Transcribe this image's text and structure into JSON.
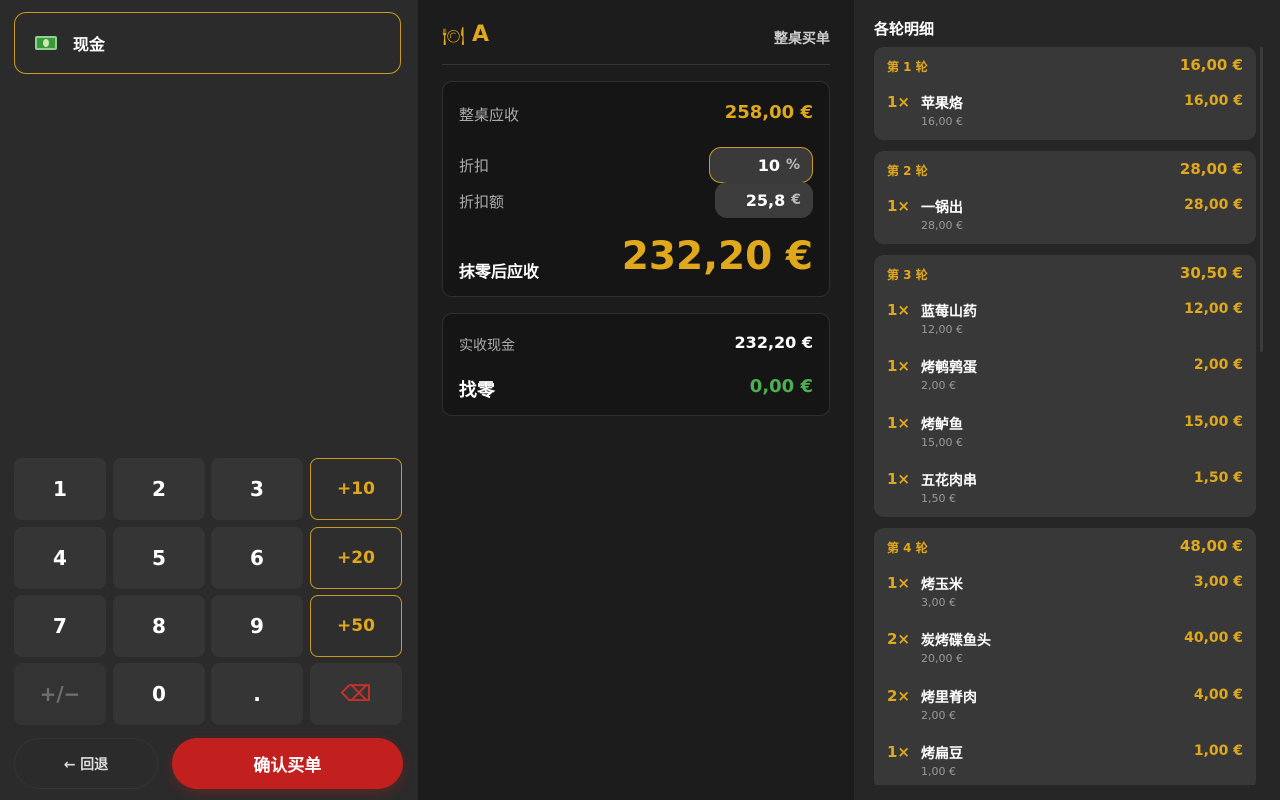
{
  "payment": {
    "method_label": "现金",
    "method_icon": "cash-icon"
  },
  "keypad": {
    "digits": [
      "1",
      "2",
      "3",
      "4",
      "5",
      "6",
      "7",
      "8",
      "9",
      "+/−",
      "0",
      "."
    ],
    "quick": [
      "+10",
      "+20",
      "+50"
    ],
    "backspace_icon": "⌫"
  },
  "actions": {
    "back_label": "← 回退",
    "confirm_label": "确认买单"
  },
  "header": {
    "table_icon": "🍽",
    "table_name": "A",
    "whole_table_label": "整桌买单"
  },
  "summary": {
    "receivable_label": "整桌应收",
    "receivable_value": "258,00 €",
    "discount_label": "折扣",
    "discount_value": "10",
    "discount_unit": "%",
    "discount_amount_label": "折扣额",
    "discount_amount_value": "25,8",
    "discount_amount_unit": "€",
    "rounded_label": "抹零后应收",
    "rounded_value": "232,20 €"
  },
  "cash": {
    "received_label": "实收现金",
    "received_value": "232,20 €",
    "change_label": "找零",
    "change_value": "0,00 €"
  },
  "rounds_title": "各轮明细",
  "rounds": [
    {
      "name": "第 1 轮",
      "total": "16,00 €",
      "items": [
        {
          "qty": "1×",
          "name": "苹果烙",
          "unit": "16,00 €",
          "total": "16,00 €"
        }
      ]
    },
    {
      "name": "第 2 轮",
      "total": "28,00 €",
      "items": [
        {
          "qty": "1×",
          "name": "一锅出",
          "unit": "28,00 €",
          "total": "28,00 €"
        }
      ]
    },
    {
      "name": "第 3 轮",
      "total": "30,50 €",
      "items": [
        {
          "qty": "1×",
          "name": "蓝莓山药",
          "unit": "12,00 €",
          "total": "12,00 €"
        },
        {
          "qty": "1×",
          "name": "烤鹌鹑蛋",
          "unit": "2,00 €",
          "total": "2,00 €"
        },
        {
          "qty": "1×",
          "name": "烤鲈鱼",
          "unit": "15,00 €",
          "total": "15,00 €"
        },
        {
          "qty": "1×",
          "name": "五花肉串",
          "unit": "1,50 €",
          "total": "1,50 €"
        }
      ]
    },
    {
      "name": "第 4 轮",
      "total": "48,00 €",
      "items": [
        {
          "qty": "1×",
          "name": "烤玉米",
          "unit": "3,00 €",
          "total": "3,00 €"
        },
        {
          "qty": "2×",
          "name": "炭烤碟鱼头",
          "unit": "20,00 €",
          "total": "40,00 €"
        },
        {
          "qty": "2×",
          "name": "烤里脊肉",
          "unit": "2,00 €",
          "total": "4,00 €"
        },
        {
          "qty": "1×",
          "name": "烤扁豆",
          "unit": "1,00 €",
          "total": "1,00 €"
        }
      ]
    }
  ],
  "colors": {
    "accent": "#e0a81c",
    "confirm": "#c21f1f",
    "change": "#4caf50",
    "backspace": "#c8302a"
  }
}
